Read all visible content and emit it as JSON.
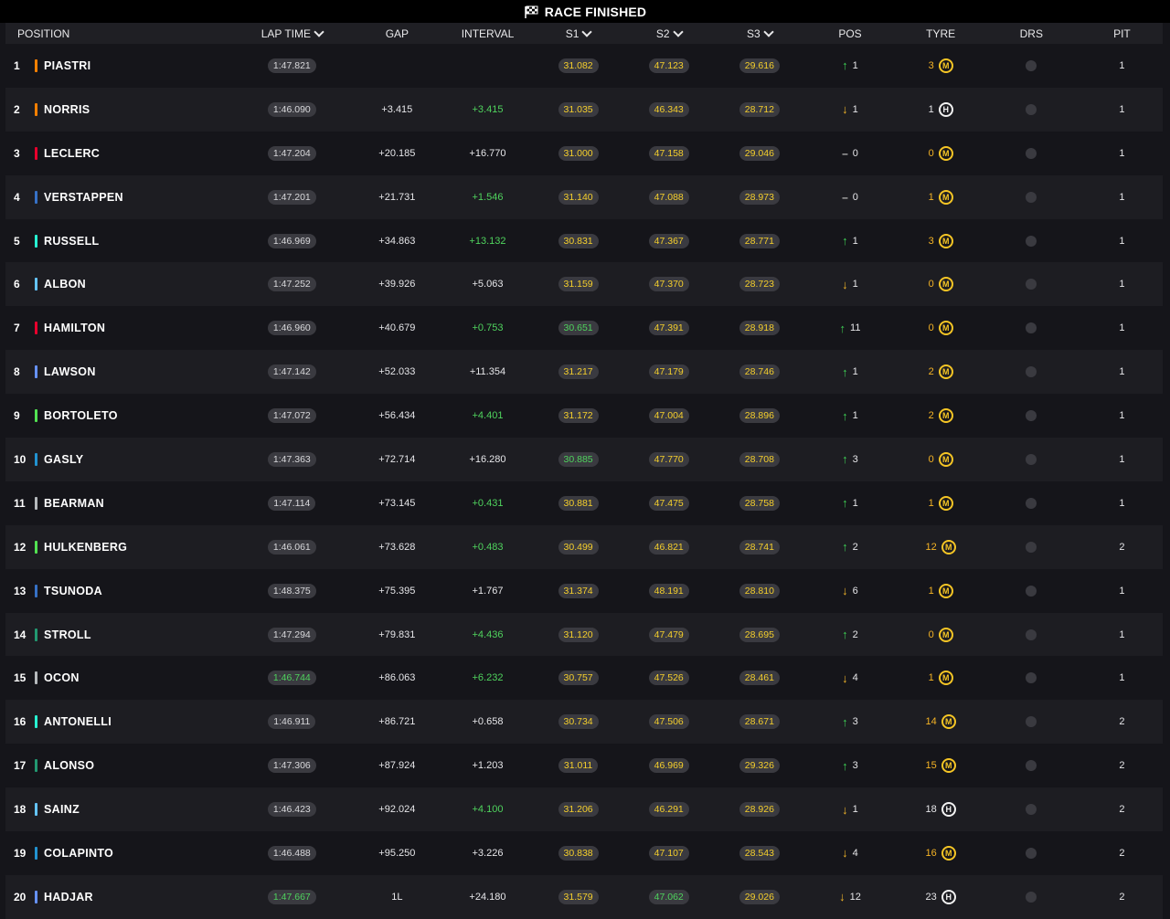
{
  "status": "RACE FINISHED",
  "columns": {
    "position": "POSITION",
    "lap_time": "LAP TIME",
    "gap": "GAP",
    "interval": "INTERVAL",
    "s1": "S1",
    "s2": "S2",
    "s3": "S3",
    "pos": "POS",
    "tyre": "TYRE",
    "drs": "DRS",
    "pit": "PIT"
  },
  "colors": {
    "green": "#4fd35d",
    "yellow": "#f5cf2c",
    "pill_bg": "#3a3a40",
    "team_mclaren": "#ff8000",
    "team_ferrari": "#e8002d",
    "team_redbull": "#3671c6",
    "team_mercedes": "#27f4d2",
    "team_williams": "#64c4ff",
    "team_rb": "#6692ff",
    "team_sauber": "#52e252",
    "team_alpine": "#2293d1",
    "team_haas": "#b6babd",
    "team_aston": "#229971"
  },
  "rows": [
    {
      "num": "1",
      "name": "PIASTRI",
      "team_color": "#ff8000",
      "lap": "1:47.821",
      "lap_c": "",
      "gap": "",
      "int": "",
      "int_c": "",
      "s1": "31.082",
      "s1_c": "y",
      "s2": "47.123",
      "s2_c": "y",
      "s3": "29.616",
      "s3_c": "y",
      "pos_dir": "up",
      "pos": "1",
      "tyre_val": "3",
      "tyre_val_c": "y",
      "tyre": "M",
      "pit": "1"
    },
    {
      "num": "2",
      "name": "NORRIS",
      "team_color": "#ff8000",
      "lap": "1:46.090",
      "lap_c": "",
      "gap": "+3.415",
      "int": "+3.415",
      "int_c": "green",
      "s1": "31.035",
      "s1_c": "y",
      "s2": "46.343",
      "s2_c": "y",
      "s3": "28.712",
      "s3_c": "y",
      "pos_dir": "down",
      "pos": "1",
      "tyre_val": "1",
      "tyre_val_c": "w",
      "tyre": "H",
      "pit": "1"
    },
    {
      "num": "3",
      "name": "LECLERC",
      "team_color": "#e8002d",
      "lap": "1:47.204",
      "lap_c": "",
      "gap": "+20.185",
      "int": "+16.770",
      "int_c": "",
      "s1": "31.000",
      "s1_c": "y",
      "s2": "47.158",
      "s2_c": "y",
      "s3": "29.046",
      "s3_c": "y",
      "pos_dir": "same",
      "pos": "0",
      "tyre_val": "0",
      "tyre_val_c": "y",
      "tyre": "M",
      "pit": "1"
    },
    {
      "num": "4",
      "name": "VERSTAPPEN",
      "team_color": "#3671c6",
      "lap": "1:47.201",
      "lap_c": "",
      "gap": "+21.731",
      "int": "+1.546",
      "int_c": "green",
      "s1": "31.140",
      "s1_c": "y",
      "s2": "47.088",
      "s2_c": "y",
      "s3": "28.973",
      "s3_c": "y",
      "pos_dir": "same",
      "pos": "0",
      "tyre_val": "1",
      "tyre_val_c": "y",
      "tyre": "M",
      "pit": "1"
    },
    {
      "num": "5",
      "name": "RUSSELL",
      "team_color": "#27f4d2",
      "lap": "1:46.969",
      "lap_c": "",
      "gap": "+34.863",
      "int": "+13.132",
      "int_c": "green",
      "s1": "30.831",
      "s1_c": "y",
      "s2": "47.367",
      "s2_c": "y",
      "s3": "28.771",
      "s3_c": "y",
      "pos_dir": "up",
      "pos": "1",
      "tyre_val": "3",
      "tyre_val_c": "y",
      "tyre": "M",
      "pit": "1"
    },
    {
      "num": "6",
      "name": "ALBON",
      "team_color": "#64c4ff",
      "lap": "1:47.252",
      "lap_c": "",
      "gap": "+39.926",
      "int": "+5.063",
      "int_c": "",
      "s1": "31.159",
      "s1_c": "y",
      "s2": "47.370",
      "s2_c": "y",
      "s3": "28.723",
      "s3_c": "y",
      "pos_dir": "down",
      "pos": "1",
      "tyre_val": "0",
      "tyre_val_c": "y",
      "tyre": "M",
      "pit": "1"
    },
    {
      "num": "7",
      "name": "HAMILTON",
      "team_color": "#e8002d",
      "lap": "1:46.960",
      "lap_c": "",
      "gap": "+40.679",
      "int": "+0.753",
      "int_c": "green",
      "s1": "30.651",
      "s1_c": "g",
      "s2": "47.391",
      "s2_c": "y",
      "s3": "28.918",
      "s3_c": "y",
      "pos_dir": "up",
      "pos": "11",
      "tyre_val": "0",
      "tyre_val_c": "y",
      "tyre": "M",
      "pit": "1"
    },
    {
      "num": "8",
      "name": "LAWSON",
      "team_color": "#6692ff",
      "lap": "1:47.142",
      "lap_c": "",
      "gap": "+52.033",
      "int": "+11.354",
      "int_c": "",
      "s1": "31.217",
      "s1_c": "y",
      "s2": "47.179",
      "s2_c": "y",
      "s3": "28.746",
      "s3_c": "y",
      "pos_dir": "up",
      "pos": "1",
      "tyre_val": "2",
      "tyre_val_c": "y",
      "tyre": "M",
      "pit": "1"
    },
    {
      "num": "9",
      "name": "BORTOLETO",
      "team_color": "#52e252",
      "lap": "1:47.072",
      "lap_c": "",
      "gap": "+56.434",
      "int": "+4.401",
      "int_c": "green",
      "s1": "31.172",
      "s1_c": "y",
      "s2": "47.004",
      "s2_c": "y",
      "s3": "28.896",
      "s3_c": "y",
      "pos_dir": "up",
      "pos": "1",
      "tyre_val": "2",
      "tyre_val_c": "y",
      "tyre": "M",
      "pit": "1"
    },
    {
      "num": "10",
      "name": "GASLY",
      "team_color": "#2293d1",
      "lap": "1:47.363",
      "lap_c": "",
      "gap": "+72.714",
      "int": "+16.280",
      "int_c": "",
      "s1": "30.885",
      "s1_c": "g",
      "s2": "47.770",
      "s2_c": "y",
      "s3": "28.708",
      "s3_c": "y",
      "pos_dir": "up",
      "pos": "3",
      "tyre_val": "0",
      "tyre_val_c": "y",
      "tyre": "M",
      "pit": "1"
    },
    {
      "num": "11",
      "name": "BEARMAN",
      "team_color": "#b6babd",
      "lap": "1:47.114",
      "lap_c": "",
      "gap": "+73.145",
      "int": "+0.431",
      "int_c": "green",
      "s1": "30.881",
      "s1_c": "y",
      "s2": "47.475",
      "s2_c": "y",
      "s3": "28.758",
      "s3_c": "y",
      "pos_dir": "up",
      "pos": "1",
      "tyre_val": "1",
      "tyre_val_c": "y",
      "tyre": "M",
      "pit": "1"
    },
    {
      "num": "12",
      "name": "HULKENBERG",
      "team_color": "#52e252",
      "lap": "1:46.061",
      "lap_c": "",
      "gap": "+73.628",
      "int": "+0.483",
      "int_c": "green",
      "s1": "30.499",
      "s1_c": "y",
      "s2": "46.821",
      "s2_c": "y",
      "s3": "28.741",
      "s3_c": "y",
      "pos_dir": "up",
      "pos": "2",
      "tyre_val": "12",
      "tyre_val_c": "y",
      "tyre": "M",
      "pit": "2"
    },
    {
      "num": "13",
      "name": "TSUNODA",
      "team_color": "#3671c6",
      "lap": "1:48.375",
      "lap_c": "",
      "gap": "+75.395",
      "int": "+1.767",
      "int_c": "",
      "s1": "31.374",
      "s1_c": "y",
      "s2": "48.191",
      "s2_c": "y",
      "s3": "28.810",
      "s3_c": "y",
      "pos_dir": "down",
      "pos": "6",
      "tyre_val": "1",
      "tyre_val_c": "y",
      "tyre": "M",
      "pit": "1"
    },
    {
      "num": "14",
      "name": "STROLL",
      "team_color": "#229971",
      "lap": "1:47.294",
      "lap_c": "",
      "gap": "+79.831",
      "int": "+4.436",
      "int_c": "green",
      "s1": "31.120",
      "s1_c": "y",
      "s2": "47.479",
      "s2_c": "y",
      "s3": "28.695",
      "s3_c": "y",
      "pos_dir": "up",
      "pos": "2",
      "tyre_val": "0",
      "tyre_val_c": "y",
      "tyre": "M",
      "pit": "1"
    },
    {
      "num": "15",
      "name": "OCON",
      "team_color": "#b6babd",
      "lap": "1:46.744",
      "lap_c": "green",
      "gap": "+86.063",
      "int": "+6.232",
      "int_c": "green",
      "s1": "30.757",
      "s1_c": "y",
      "s2": "47.526",
      "s2_c": "y",
      "s3": "28.461",
      "s3_c": "y",
      "pos_dir": "down",
      "pos": "4",
      "tyre_val": "1",
      "tyre_val_c": "y",
      "tyre": "M",
      "pit": "1"
    },
    {
      "num": "16",
      "name": "ANTONELLI",
      "team_color": "#27f4d2",
      "lap": "1:46.911",
      "lap_c": "",
      "gap": "+86.721",
      "int": "+0.658",
      "int_c": "",
      "s1": "30.734",
      "s1_c": "y",
      "s2": "47.506",
      "s2_c": "y",
      "s3": "28.671",
      "s3_c": "y",
      "pos_dir": "up",
      "pos": "3",
      "tyre_val": "14",
      "tyre_val_c": "y",
      "tyre": "M",
      "pit": "2"
    },
    {
      "num": "17",
      "name": "ALONSO",
      "team_color": "#229971",
      "lap": "1:47.306",
      "lap_c": "",
      "gap": "+87.924",
      "int": "+1.203",
      "int_c": "",
      "s1": "31.011",
      "s1_c": "y",
      "s2": "46.969",
      "s2_c": "y",
      "s3": "29.326",
      "s3_c": "y",
      "pos_dir": "up",
      "pos": "3",
      "tyre_val": "15",
      "tyre_val_c": "y",
      "tyre": "M",
      "pit": "2"
    },
    {
      "num": "18",
      "name": "SAINZ",
      "team_color": "#64c4ff",
      "lap": "1:46.423",
      "lap_c": "",
      "gap": "+92.024",
      "int": "+4.100",
      "int_c": "green",
      "s1": "31.206",
      "s1_c": "y",
      "s2": "46.291",
      "s2_c": "y",
      "s3": "28.926",
      "s3_c": "y",
      "pos_dir": "down",
      "pos": "1",
      "tyre_val": "18",
      "tyre_val_c": "w",
      "tyre": "H",
      "pit": "2"
    },
    {
      "num": "19",
      "name": "COLAPINTO",
      "team_color": "#2293d1",
      "lap": "1:46.488",
      "lap_c": "",
      "gap": "+95.250",
      "int": "+3.226",
      "int_c": "",
      "s1": "30.838",
      "s1_c": "y",
      "s2": "47.107",
      "s2_c": "y",
      "s3": "28.543",
      "s3_c": "y",
      "pos_dir": "down",
      "pos": "4",
      "tyre_val": "16",
      "tyre_val_c": "y",
      "tyre": "M",
      "pit": "2"
    },
    {
      "num": "20",
      "name": "HADJAR",
      "team_color": "#6692ff",
      "lap": "1:47.667",
      "lap_c": "green",
      "gap": "1L",
      "int": "+24.180",
      "int_c": "",
      "s1": "31.579",
      "s1_c": "y",
      "s2": "47.062",
      "s2_c": "g",
      "s3": "29.026",
      "s3_c": "y",
      "pos_dir": "down",
      "pos": "12",
      "tyre_val": "23",
      "tyre_val_c": "w",
      "tyre": "H",
      "pit": "2"
    }
  ]
}
